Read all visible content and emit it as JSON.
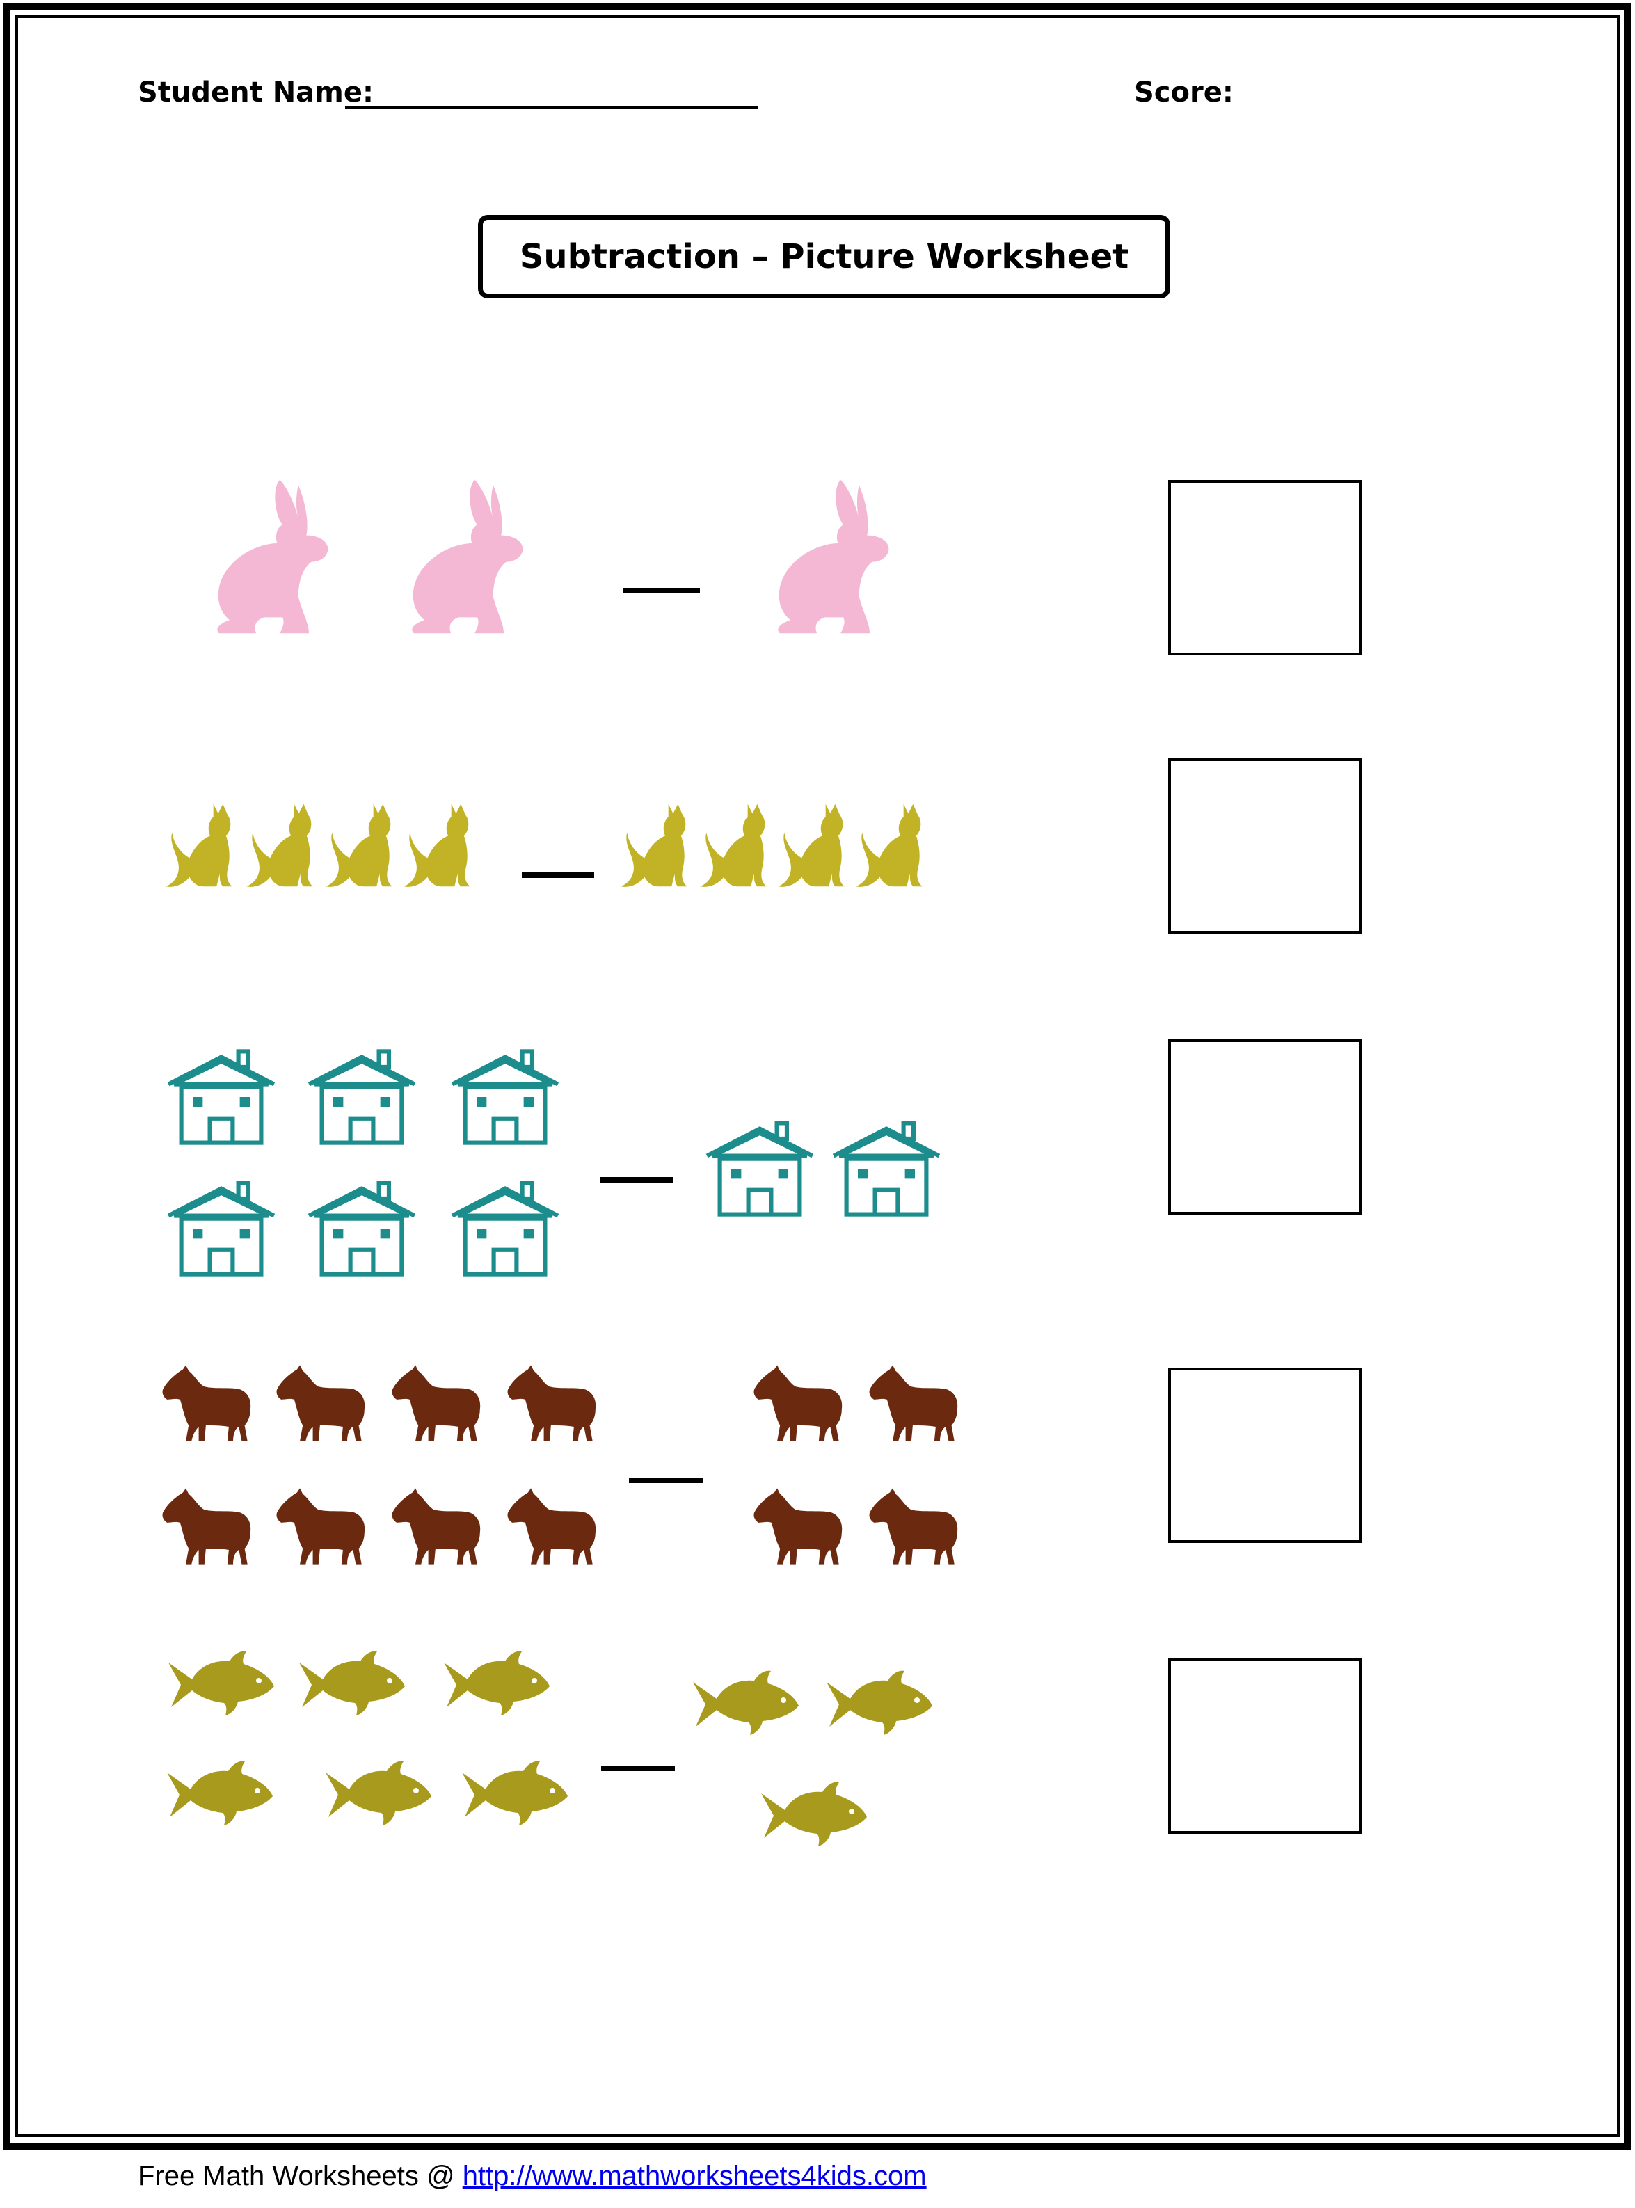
{
  "header": {
    "student_name_label": "Student Name:",
    "score_label": "Score:"
  },
  "title": "Subtraction – Picture Worksheet",
  "problems": [
    {
      "icon": "rabbit-icon",
      "color": "#f4b8d4",
      "minuend": 2,
      "subtrahend": 1
    },
    {
      "icon": "cat-icon",
      "color": "#c1b325",
      "minuend": 4,
      "subtrahend": 4
    },
    {
      "icon": "house-icon",
      "color": "#1c8c8c",
      "minuend": 6,
      "subtrahend": 2
    },
    {
      "icon": "horse-icon",
      "color": "#6b2a10",
      "minuend": 8,
      "subtrahend": 4
    },
    {
      "icon": "fish-icon",
      "color": "#a89a1c",
      "minuend": 6,
      "subtrahend": 3
    }
  ],
  "footer": {
    "text": "Free Math Worksheets @ ",
    "link": "http://www.mathworksheets4kids.com"
  }
}
